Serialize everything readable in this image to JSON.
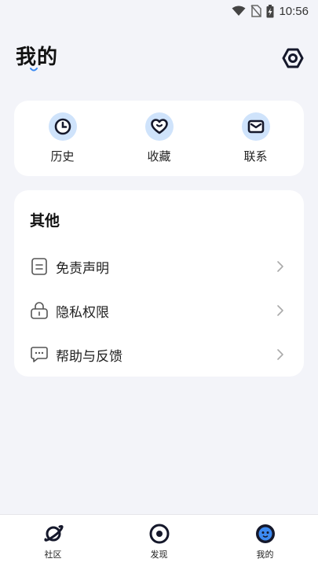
{
  "status_bar": {
    "time": "10:56",
    "icons": [
      "wifi-icon",
      "no-sim-icon",
      "battery-charging-icon"
    ]
  },
  "header": {
    "title": "我的",
    "settings_icon": "settings-hexagon-icon"
  },
  "quick_actions": [
    {
      "label": "历史",
      "icon": "clock-icon"
    },
    {
      "label": "收藏",
      "icon": "heart-icon"
    },
    {
      "label": "联系",
      "icon": "mail-icon"
    }
  ],
  "other": {
    "title": "其他",
    "items": [
      {
        "label": "免责声明",
        "icon": "document-icon"
      },
      {
        "label": "隐私权限",
        "icon": "lock-icon"
      },
      {
        "label": "帮助与反馈",
        "icon": "chat-bubble-icon"
      }
    ]
  },
  "tab_bar": {
    "tabs": [
      {
        "label": "社区",
        "icon": "planet-icon",
        "active": false
      },
      {
        "label": "发现",
        "icon": "eye-target-icon",
        "active": false
      },
      {
        "label": "我的",
        "icon": "face-icon",
        "active": true
      }
    ]
  },
  "colors": {
    "background": "#f3f4f9",
    "card": "#ffffff",
    "icon_bg": "#cfe3fb",
    "accent": "#3d8bf2",
    "icon_dark": "#15182b"
  }
}
